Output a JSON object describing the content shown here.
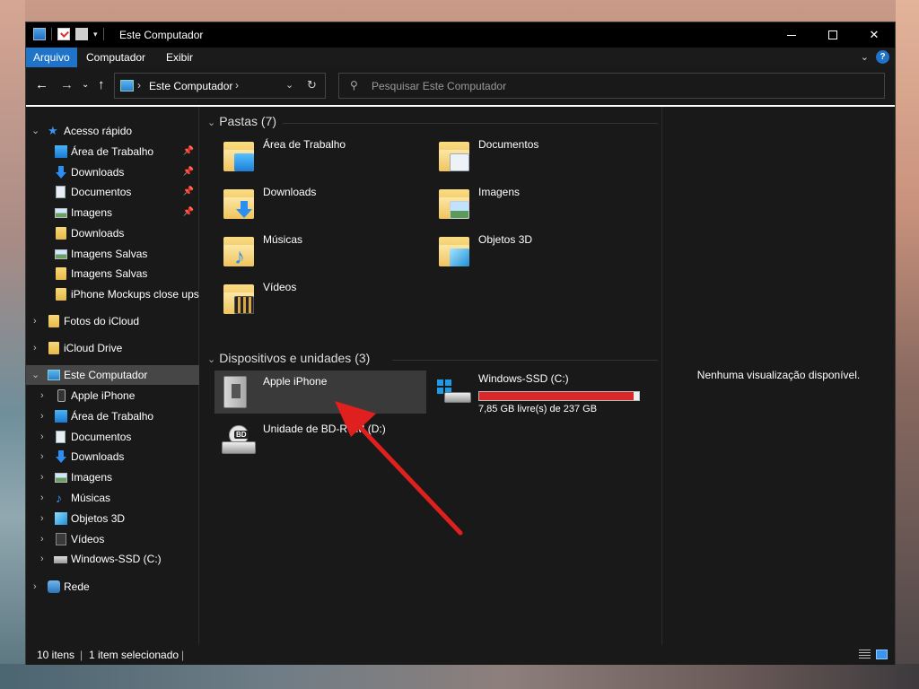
{
  "window": {
    "title": "Este Computador"
  },
  "ribbon": {
    "tabs": [
      "Arquivo",
      "Computador",
      "Exibir"
    ],
    "help": "?"
  },
  "address": {
    "location": "Este Computador",
    "separator": "›",
    "refresh": "↻"
  },
  "search": {
    "placeholder": "Pesquisar Este Computador"
  },
  "sidebar": {
    "items": [
      {
        "label": "Acesso rápido",
        "icon": "star-icon"
      },
      {
        "label": "Área de Trabalho",
        "icon": "desktop-icon",
        "pinned": true
      },
      {
        "label": "Downloads",
        "icon": "download-icon",
        "pinned": true
      },
      {
        "label": "Documentos",
        "icon": "document-icon",
        "pinned": true
      },
      {
        "label": "Imagens",
        "icon": "image-icon",
        "pinned": true
      },
      {
        "label": "Downloads",
        "icon": "folder-icon"
      },
      {
        "label": "Imagens Salvas",
        "icon": "image-icon"
      },
      {
        "label": "Imagens Salvas",
        "icon": "folder-icon"
      },
      {
        "label": "iPhone Mockups close ups",
        "icon": "folder-icon"
      },
      {
        "label": "Fotos do iCloud",
        "icon": "folder-icon"
      },
      {
        "label": "iCloud Drive",
        "icon": "folder-icon"
      },
      {
        "label": "Este Computador",
        "icon": "computer-icon"
      },
      {
        "label": "Apple iPhone",
        "icon": "phone-icon"
      },
      {
        "label": "Área de Trabalho",
        "icon": "desktop-icon"
      },
      {
        "label": "Documentos",
        "icon": "document-icon"
      },
      {
        "label": "Downloads",
        "icon": "download-icon"
      },
      {
        "label": "Imagens",
        "icon": "image-icon"
      },
      {
        "label": "Músicas",
        "icon": "music-icon"
      },
      {
        "label": "Objetos 3D",
        "icon": "cube-icon"
      },
      {
        "label": "Vídeos",
        "icon": "video-icon"
      },
      {
        "label": "Windows-SSD (C:)",
        "icon": "drive-icon"
      },
      {
        "label": "Rede",
        "icon": "network-icon"
      }
    ]
  },
  "content": {
    "folders_header": "Pastas (7)",
    "folders": [
      {
        "label": "Área de Trabalho",
        "icon": "desktop-folder-icon"
      },
      {
        "label": "Documentos",
        "icon": "documents-folder-icon"
      },
      {
        "label": "Downloads",
        "icon": "downloads-folder-icon"
      },
      {
        "label": "Imagens",
        "icon": "images-folder-icon"
      },
      {
        "label": "Músicas",
        "icon": "music-folder-icon"
      },
      {
        "label": "Objetos 3D",
        "icon": "3d-objects-folder-icon"
      },
      {
        "label": "Vídeos",
        "icon": "videos-folder-icon"
      }
    ],
    "devices_header": "Dispositivos e unidades (3)",
    "devices": [
      {
        "label": "Apple iPhone",
        "icon": "iphone-device-icon"
      },
      {
        "label": "Windows-SSD (C:)",
        "icon": "ssd-drive-icon",
        "free": "7,85 GB livre(s) de 237 GB",
        "used_fraction": 0.967
      },
      {
        "label": "Unidade de BD-ROM (D:)",
        "icon": "bd-rom-drive-icon",
        "badge": "BD"
      }
    ]
  },
  "preview": {
    "message": "Nenhuma visualização disponível."
  },
  "status": {
    "count": "10 itens",
    "selected": "1 item selecionado"
  },
  "colors": {
    "accent": "#1f73c8",
    "drive_full": "#da2828",
    "annotation_arrow": "#e01f1f"
  }
}
